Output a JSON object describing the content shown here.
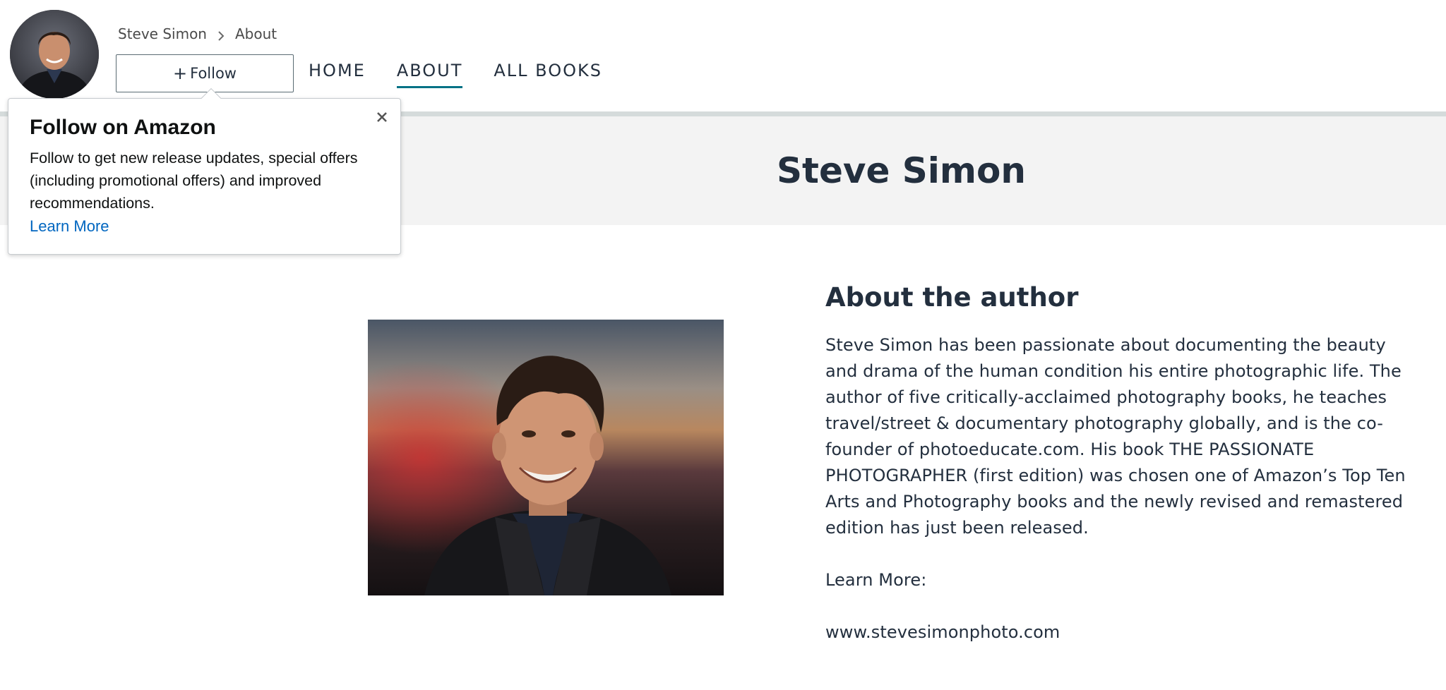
{
  "breadcrumb": {
    "author": "Steve Simon",
    "current": "About"
  },
  "header": {
    "follow_label": "Follow",
    "nav": [
      {
        "label": "HOME",
        "active": false
      },
      {
        "label": "ABOUT",
        "active": true
      },
      {
        "label": "ALL BOOKS",
        "active": false
      }
    ]
  },
  "banner": {
    "author_name": "Steve Simon"
  },
  "popover": {
    "title": "Follow on Amazon",
    "body": "Follow to get new release updates, special offers (including promotional offers) and improved recommendations.",
    "link": "Learn More"
  },
  "about": {
    "heading": "About the author",
    "bio": "Steve Simon has been passionate about documenting the beauty and drama of the human condition his entire photographic life. The author of five critically-acclaimed photography books, he teaches travel/street & documentary photography globally, and is the co-founder of photoeducate.com. His book THE PASSIONATE PHOTOGRAPHER (first edition) was chosen one of Amazon’s Top Ten Arts and Photography books and the newly revised and remastered edition has just been released.",
    "learn_more": "Learn More:",
    "website": "www.stevesimonphoto.com"
  },
  "colors": {
    "text": "#232f3e",
    "link": "#0066c0",
    "active_underline": "#007185",
    "banner_bg": "#f3f3f3",
    "divider": "#d5dbdb"
  },
  "icons": {
    "breadcrumb_separator": "chevron-right-icon",
    "popover_close": "close-icon",
    "follow_prefix": "plus-icon"
  }
}
